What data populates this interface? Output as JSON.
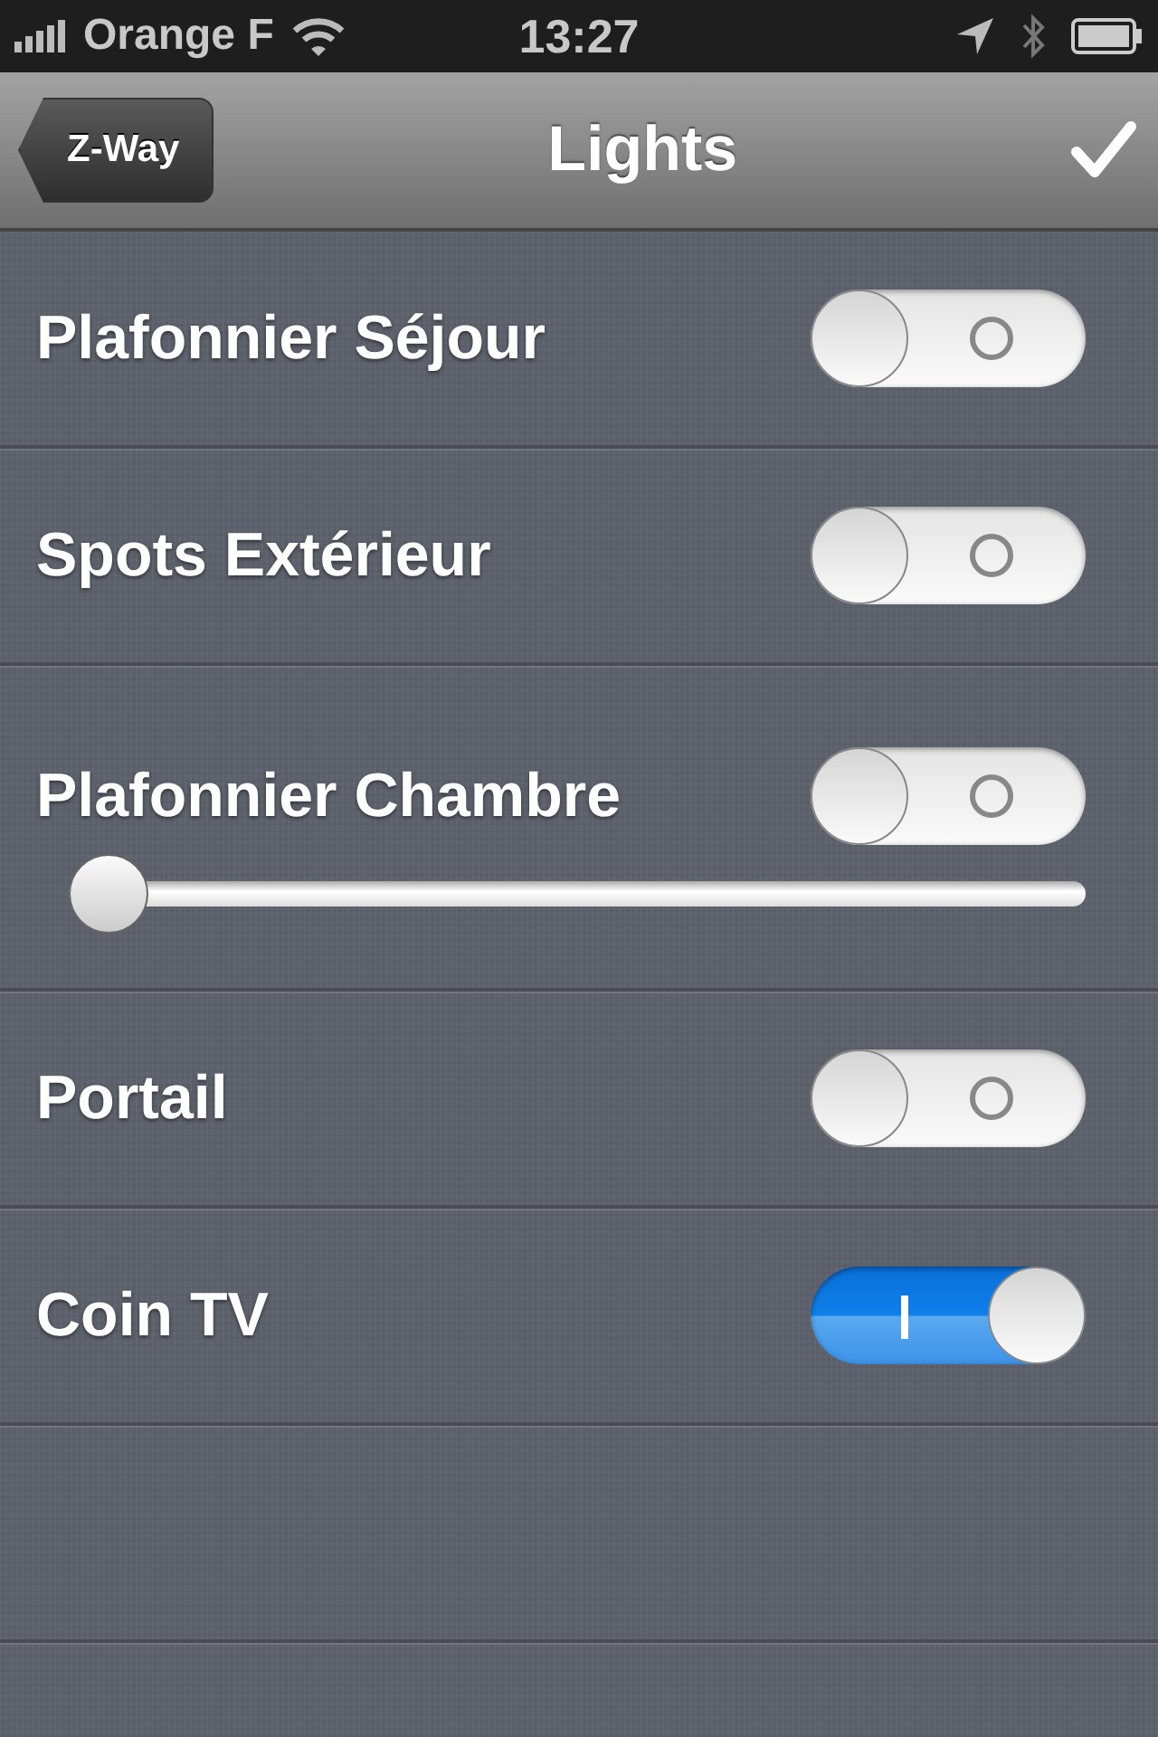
{
  "status_bar": {
    "carrier": "Orange F",
    "time": "13:27"
  },
  "nav": {
    "back": "Z-Way",
    "title": "Lights"
  },
  "items": [
    {
      "kind": "switch",
      "label": "Plafonnier Séjour",
      "on": false
    },
    {
      "kind": "switch",
      "label": "Spots Extérieur",
      "on": false
    },
    {
      "kind": "dimmer",
      "label": "Plafonnier Chambre",
      "on": false,
      "level": 0
    },
    {
      "kind": "switch",
      "label": "Portail",
      "on": false
    },
    {
      "kind": "switch",
      "label": "Coin TV",
      "on": true
    }
  ]
}
